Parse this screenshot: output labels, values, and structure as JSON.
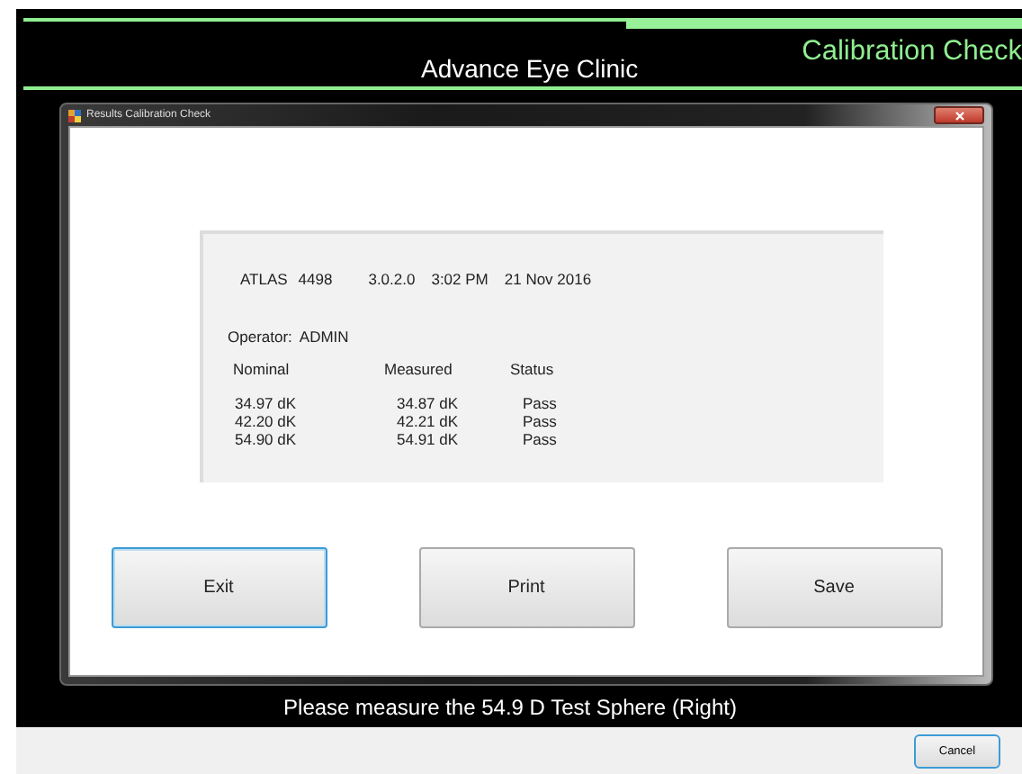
{
  "header": {
    "clinic": "Advance Eye Clinic",
    "title": "Calibration Check"
  },
  "dialog": {
    "title": "Results Calibration Check",
    "summary": {
      "device": "ATLAS",
      "serial": "4498",
      "version": "3.0.2.0",
      "time": "3:02 PM",
      "date": "21 Nov 2016",
      "operator_label": "Operator:",
      "operator": "ADMIN"
    },
    "columns": [
      "Nominal",
      "Measured",
      "Status"
    ],
    "rows": [
      [
        "34.97 dK",
        "34.87 dK",
        "Pass"
      ],
      [
        "42.20 dK",
        "42.21 dK",
        "Pass"
      ],
      [
        "54.90 dK",
        "54.91 dK",
        "Pass"
      ]
    ],
    "buttons": [
      {
        "label": "Exit",
        "focused": true
      },
      {
        "label": "Print",
        "focused": false
      },
      {
        "label": "Save",
        "focused": false
      }
    ]
  },
  "instruction": "Please measure the 54.9 D Test Sphere (Right)",
  "cancel": "Cancel"
}
